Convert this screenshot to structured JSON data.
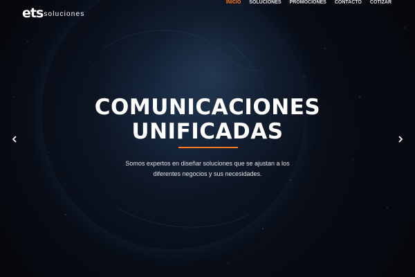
{
  "brand": {
    "logo_mark": "ets",
    "logo_text": "soluciones"
  },
  "nav": {
    "items": [
      {
        "label": "INICIO",
        "active": true
      },
      {
        "label": "SOLUCIONES",
        "active": false
      },
      {
        "label": "PROMOCIONES",
        "active": false
      },
      {
        "label": "CONTACTO",
        "active": false
      },
      {
        "label": "COTIZAR",
        "active": false
      }
    ]
  },
  "hero": {
    "title_line1": "COMUNICACIONES",
    "title_line2": "UNIFICADAS",
    "subtitle_line1": "Somos expertos en diseñar soluciones que se ajustan a los",
    "subtitle_line2": "diferentes negocios y sus necesidades.",
    "prev_icon": "chevron-left-icon",
    "next_icon": "chevron-right-icon"
  },
  "colors": {
    "accent": "#ff7a1a",
    "background": "#05070c",
    "text": "#ffffff"
  }
}
